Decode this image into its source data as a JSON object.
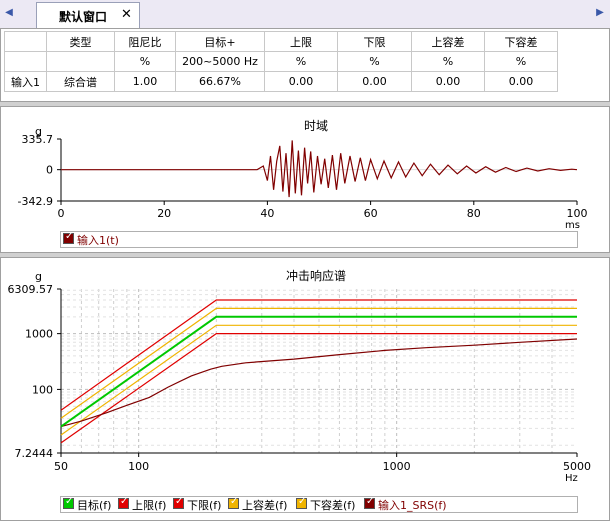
{
  "tab": {
    "label": "默认窗口"
  },
  "table": {
    "header": [
      "",
      "类型",
      "阻尼比",
      "目标+",
      "上限",
      "下限",
      "上容差",
      "下容差"
    ],
    "units": [
      "",
      "",
      "%",
      "200~5000 Hz",
      "%",
      "%",
      "%",
      "%"
    ],
    "row": [
      "输入1",
      "综合谱",
      "1.00",
      "66.67%",
      "0.00",
      "0.00",
      "0.00",
      "0.00"
    ]
  },
  "time_chart": {
    "title": "时域",
    "unit_y": "g",
    "unit_x": "ms",
    "legend": [
      "输入1(t)"
    ]
  },
  "srs_chart": {
    "title": "冲击响应谱",
    "unit_y": "g",
    "unit_x": "Hz",
    "legend": [
      "目标(f)",
      "上限(f)",
      "下限(f)",
      "上容差(f)",
      "下容差(f)",
      "输入1_SRS(f)"
    ]
  },
  "colors": {
    "target": "#00c800",
    "upper": "#e00000",
    "lower": "#e00000",
    "upper_tol": "#f0b400",
    "lower_tol": "#f0b400",
    "srs": "#800000",
    "signal": "#800000"
  },
  "chart_data": [
    {
      "type": "line",
      "title": "时域",
      "xlabel": "ms",
      "ylabel": "g",
      "xlim": [
        0,
        100
      ],
      "ylim": [
        -342.9,
        335.7
      ],
      "x_ticks": [
        0,
        20,
        40,
        60,
        80,
        100
      ],
      "y_ticks": [
        -342.9,
        0,
        335.7
      ],
      "grid": false,
      "legend_position": "bottom-left",
      "series": [
        {
          "name": "输入1(t)",
          "x": [
            0,
            38,
            39.2,
            40,
            40.6,
            41.2,
            41.8,
            42.4,
            43,
            43.6,
            44.2,
            44.8,
            45.4,
            46,
            46.6,
            47.2,
            47.8,
            48.4,
            49,
            49.7,
            50.4,
            51.1,
            51.8,
            52.6,
            53.4,
            54.2,
            55,
            56,
            57,
            58,
            59,
            60,
            61.3,
            62.6,
            64,
            65.4,
            66.8,
            68.4,
            70,
            71.6,
            73.3,
            75,
            76.8,
            78.6,
            80.4,
            82.3,
            84.2,
            86.2,
            88.2,
            90.3,
            92.4,
            94.6,
            96.8,
            99,
            100
          ],
          "y": [
            0,
            0,
            40,
            -120,
            150,
            -220,
            90,
            260,
            -240,
            180,
            -300,
            320,
            -260,
            210,
            -280,
            240,
            -150,
            200,
            -250,
            150,
            -160,
            120,
            -200,
            160,
            -220,
            180,
            -150,
            150,
            -130,
            130,
            -120,
            110,
            -100,
            95,
            -90,
            85,
            -80,
            72,
            -66,
            60,
            -55,
            50,
            -45,
            40,
            -36,
            32,
            -28,
            24,
            -20,
            17,
            -14,
            11,
            -8,
            5,
            0
          ]
        }
      ]
    },
    {
      "type": "line",
      "title": "冲击响应谱",
      "xlabel": "Hz",
      "ylabel": "g",
      "xscale": "log",
      "yscale": "log",
      "xlim": [
        50,
        5000
      ],
      "ylim": [
        7.2444,
        6309.57
      ],
      "x_ticks": [
        50,
        100,
        1000,
        5000
      ],
      "y_ticks": [
        7.2444,
        100,
        1000,
        6309.57
      ],
      "grid": true,
      "legend_position": "bottom-left",
      "series": [
        {
          "name": "目标(f)",
          "x": [
            50,
            200,
            5000
          ],
          "y": [
            21.5,
            2000,
            2000
          ]
        },
        {
          "name": "上限(f)",
          "x": [
            50,
            200,
            5000
          ],
          "y": [
            42.4,
            4000,
            4000
          ]
        },
        {
          "name": "下限(f)",
          "x": [
            50,
            200,
            5000
          ],
          "y": [
            11,
            1000,
            1000
          ]
        },
        {
          "name": "上容差(f)",
          "x": [
            50,
            200,
            5000
          ],
          "y": [
            30.5,
            2830,
            2830
          ]
        },
        {
          "name": "下容差(f)",
          "x": [
            50,
            200,
            5000
          ],
          "y": [
            15.2,
            1410,
            1410
          ]
        },
        {
          "name": "输入1_SRS(f)",
          "x": [
            50,
            60,
            75,
            90,
            110,
            130,
            160,
            190,
            210,
            260,
            400,
            600,
            900,
            1300,
            2000,
            3000,
            5000
          ],
          "y": [
            21.5,
            27,
            38,
            52,
            72,
            110,
            175,
            230,
            260,
            300,
            350,
            420,
            500,
            560,
            620,
            700,
            800
          ]
        }
      ]
    }
  ]
}
